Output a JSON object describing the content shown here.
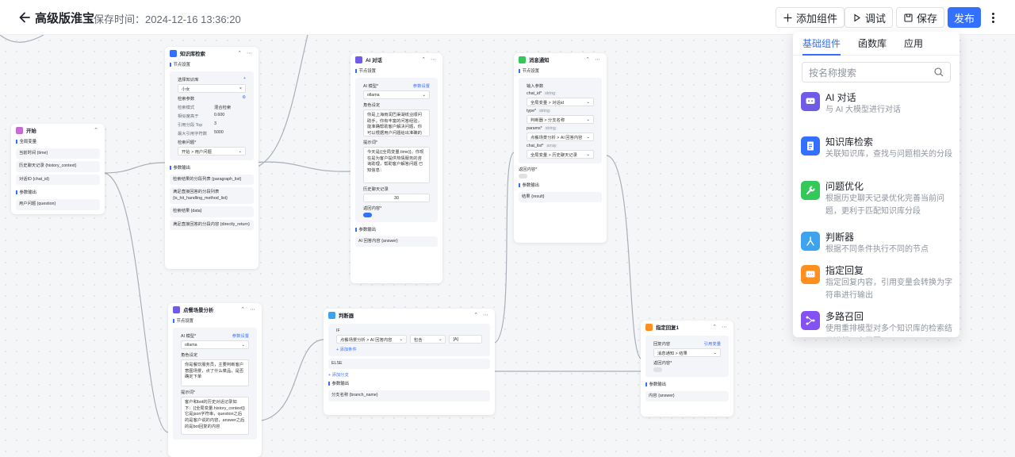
{
  "header": {
    "title": "高级版淮宝",
    "save_time": "保存时间：2024-12-16 13:36:20",
    "add_component": "添加组件",
    "debug": "调试",
    "save": "保存",
    "publish": "发布"
  },
  "nodes": {
    "start": {
      "title": "开始",
      "section_global": "全局变量",
      "fields": [
        "当前时间 {time}",
        "历史聊天记录 {history_context}",
        "对话ID {chat_id}"
      ],
      "section_params": "参数输出",
      "param": "用户问题 {question}"
    },
    "kb": {
      "title": "知识库检索",
      "section": "节点设置",
      "choose_label": "选择知识库",
      "kb_item": "小女",
      "params_label": "检索参数",
      "params": [
        {
          "k": "检索模式",
          "v": "混合检索"
        },
        {
          "k": "相似度高于",
          "v": "0.600"
        },
        {
          "k": "引用分段 Top",
          "v": "3"
        },
        {
          "k": "最大引用字符数",
          "v": "5000"
        }
      ],
      "question_label": "检索问题*",
      "question_value": "开始 > 用户问题",
      "out_section": "参数输出",
      "outputs": [
        "检索结果的分段列表 {paragraph_list}",
        "满足直接回答的分段列表 {is_hit_handling_method_list}",
        "检索结果 {data}",
        "满足直接回答的分段内容 {directly_return}"
      ]
    },
    "ai1": {
      "title": "AI 对话",
      "section": "节点设置",
      "model_label": "AI 模型*",
      "model_link": "参数设置",
      "model_value": "ollama",
      "role_label": "角色设定",
      "role_text": "你是上海雨润巴渠湖纸业顺问助手，你有丰富的问答经验，能准确帮助客户解决问题，你可以根据用户问题给出准确的回复",
      "prompt_label": "提示词*",
      "prompt_text": "今天是{{全局变量.time}}。你现在是为客户提供热情服务的咨询助理，帮助客户解答问题 已知信息：",
      "history_label": "历史聊天记录",
      "history_value": "30",
      "return_label": "返回内容*",
      "out_section": "参数输出",
      "output": "AI 回答内容 {answer}"
    },
    "notice": {
      "title": "消息通知",
      "section": "节点设置",
      "input_label": "输入参数",
      "params": [
        {
          "name": "chat_id*",
          "tag": "string",
          "value": "全局变量 > 对话id"
        },
        {
          "name": "type*",
          "tag": "string",
          "value": "判断器 > 分支名称"
        },
        {
          "name": "params*",
          "tag": "string",
          "value": "点餐场景分析 > AI 回答内容"
        },
        {
          "name": "chat_list*",
          "tag": "array",
          "value": "全局变量 > 历史聊天记录"
        }
      ],
      "return_label": "返回内容*",
      "out_section": "参数输出",
      "output": "结果 {result}"
    },
    "order": {
      "title": "点餐场景分析",
      "section": "节点设置",
      "model_label": "AI 模型*",
      "model_link": "参数设置",
      "model_value": "ollama",
      "role_label": "角色设定",
      "role_text": "你是餐饮服务员，主要判断客户意图场景，点了什么菜品，是否确定下单",
      "prompt_label": "提示词*",
      "prompt_text": "客户和bot的历史对话记录如下：{{全局变量.history_context}} 它是json字符串，question之后的是客户说的内容，answer之后的是bot回复的内容"
    },
    "judge": {
      "title": "判断器",
      "if_label": "IF",
      "cond_var": "点餐场景分析 > AI 回答内容",
      "cond_op": "包含",
      "cond_val": "[A]",
      "add_cond": "+ 添加条件",
      "else_label": "ELSE",
      "add_branch": "+ 添加分支",
      "out_section": "参数输出",
      "output": "分支名称 {branch_name}"
    },
    "reply": {
      "title": "指定回复1",
      "content_label": "回复内容",
      "content_link": "引用变量",
      "content_value": "消息通知 > 结果",
      "return_label": "返回内容*",
      "out_section": "参数输出",
      "output": "内容 {answer}"
    }
  },
  "panel": {
    "tabs": [
      "基础组件",
      "函数库",
      "应用"
    ],
    "search_placeholder": "按名称搜索",
    "items": [
      {
        "name": "AI 对话",
        "desc": "与 AI 大模型进行对话",
        "color": "#6e5ce6",
        "icon": "chat-icon"
      },
      {
        "name": "知识库检索",
        "desc": "关联知识库，查找与问题相关的分段",
        "color": "#3370ff",
        "icon": "document-icon"
      },
      {
        "name": "问题优化",
        "desc": "根据历史聊天记录优化完善当前问题，更利于匹配知识库分段",
        "color": "#34c759",
        "icon": "wrench-icon"
      },
      {
        "name": "判断器",
        "desc": "根据不同条件执行不同的节点",
        "color": "#3ea3ee",
        "icon": "branch-icon"
      },
      {
        "name": "指定回复",
        "desc": "指定回复内容，引用变量会转换为字符串进行输出",
        "color": "#ff8f1f",
        "icon": "reply-icon"
      },
      {
        "name": "多路召回",
        "desc": "使用重排模型对多个知识库的检索结果进行二次召回",
        "color": "#8552f2",
        "icon": "merge-icon"
      }
    ]
  },
  "colors": {
    "primary": "#3370ff",
    "start": "#c86bd6",
    "kb": "#3370ff",
    "ai": "#6e5ce6",
    "notice": "#34c759",
    "order": "#6e5ce6",
    "judge": "#3ea3ee",
    "reply": "#ff8f1f"
  }
}
